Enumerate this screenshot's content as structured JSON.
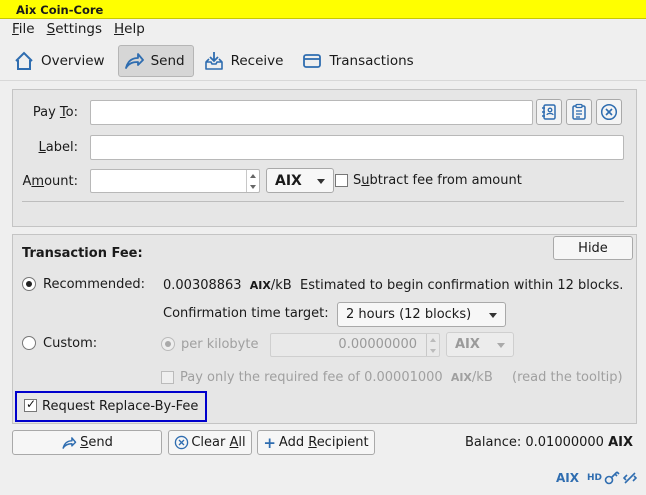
{
  "window": {
    "title": "Aix Coin-Core"
  },
  "menu": [
    {
      "pre": "",
      "u": "F",
      "post": "ile"
    },
    {
      "pre": "",
      "u": "S",
      "post": "ettings"
    },
    {
      "pre": "",
      "u": "H",
      "post": "elp"
    }
  ],
  "toolbar": {
    "overview": "Overview",
    "send": "Send",
    "receive": "Receive",
    "transactions": "Transactions"
  },
  "recipient": {
    "pay_to_label_pre": "Pay ",
    "pay_to_label_u": "T",
    "pay_to_label_post": "o:",
    "pay_to_value": "",
    "label_label_pre": "",
    "label_label_u": "L",
    "label_label_post": "abel:",
    "label_value": "",
    "amount_label_pre": "A",
    "amount_label_u": "m",
    "amount_label_post": "ount:",
    "amount_value": "",
    "unit": "AIX",
    "subtract_fee_pre": "S",
    "subtract_fee_u": "u",
    "subtract_fee_post": "btract fee from amount",
    "subtract_fee_checked": false
  },
  "fee": {
    "heading": "Transaction Fee:",
    "hide_button": "Hide",
    "recommended_label": "Recommended:",
    "recommended_selected": true,
    "recommended_value": "0.00308863",
    "recommended_unit": "AIX",
    "recommended_per": "/kB",
    "estimate_text": "Estimated to begin confirmation within 12 blocks.",
    "conf_target_label": "Confirmation time target:",
    "conf_target_value": "2 hours (12 blocks)",
    "custom_label": "Custom:",
    "custom_selected": false,
    "per_kilobyte_label": "per kilobyte",
    "custom_value": "0.00000000",
    "custom_unit": "AIX",
    "min_fee_text": "Pay only the required fee of 0.00001000",
    "min_fee_unit": "AIX",
    "min_fee_per": "/kB",
    "tooltip_hint": "(read the tooltip)",
    "rbf_label": "Request Replace-By-Fee",
    "rbf_checked": true
  },
  "actions": {
    "send_pre": "",
    "send_u": "S",
    "send_post": "end",
    "clear_pre": "Clear ",
    "clear_u": "A",
    "clear_post": "ll",
    "add_pre": "Add ",
    "add_u": "R",
    "add_post": "ecipient",
    "balance_label": "Balance:",
    "balance_value": "0.01000000",
    "balance_unit": "AIX"
  },
  "statusbar": {
    "unit": "AIX",
    "hd": "HD"
  },
  "colors": {
    "title_bg": "#ffff00",
    "accent": "#2f6db0",
    "highlight_border": "#0000cc"
  }
}
